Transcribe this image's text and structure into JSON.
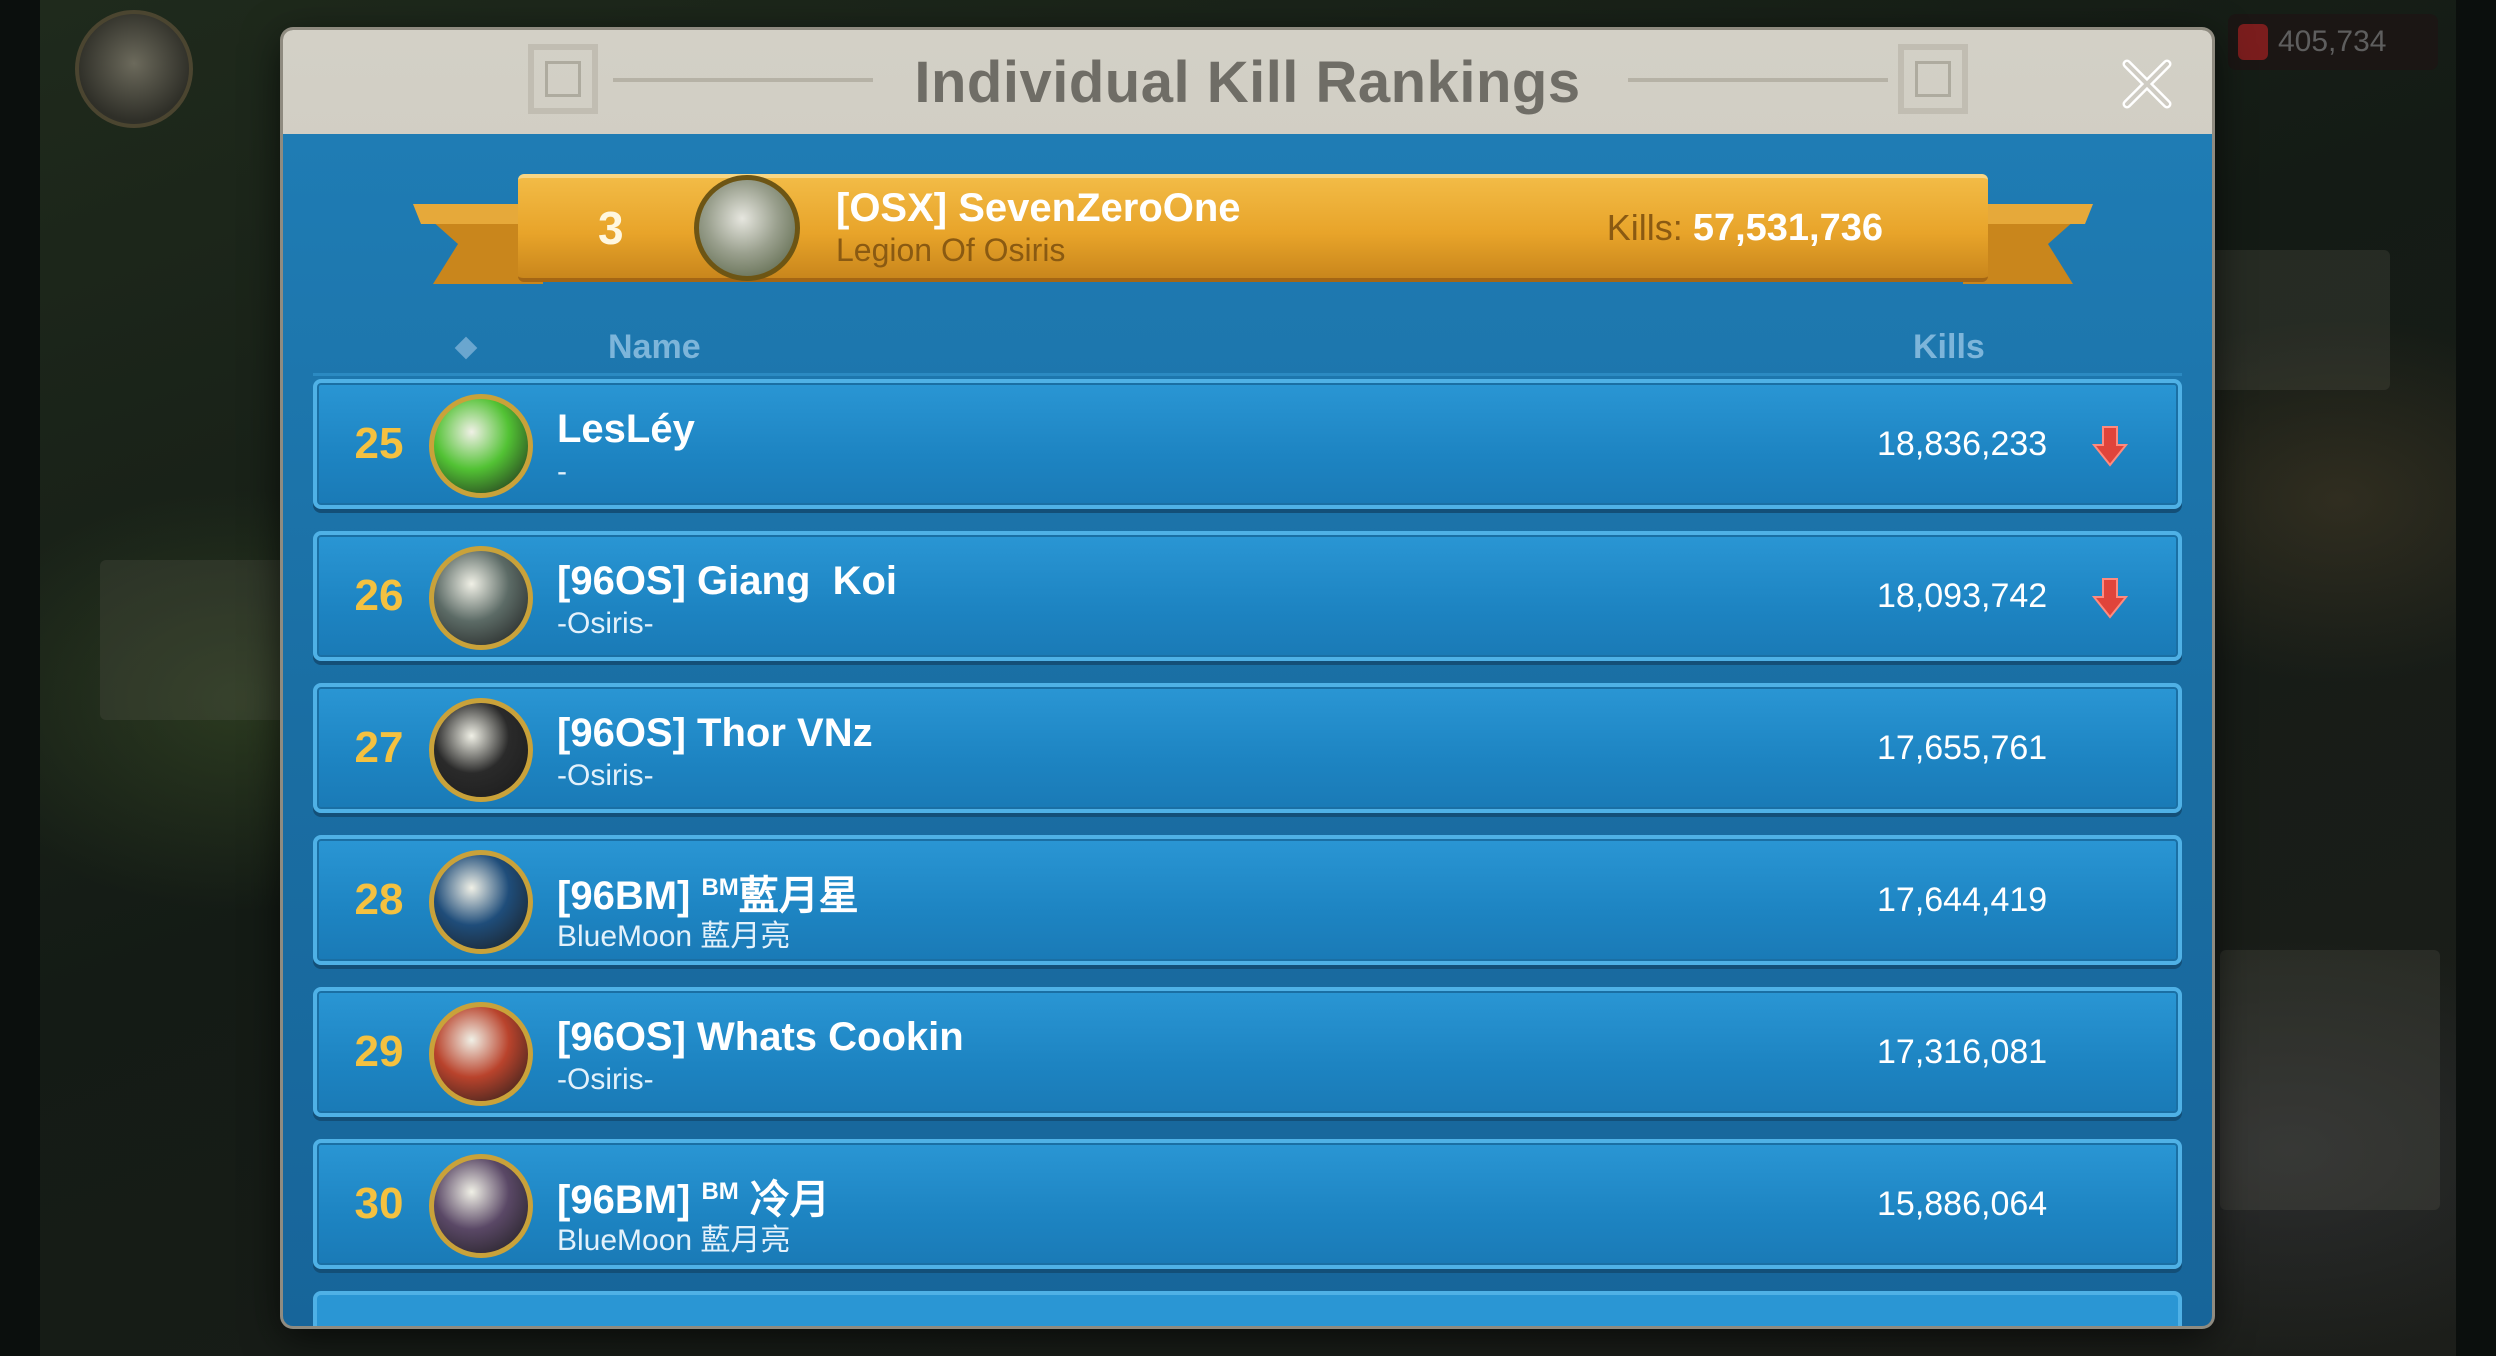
{
  "background": {
    "power_value": "405,734"
  },
  "modal": {
    "title": "Individual Kill Rankings"
  },
  "own_entry": {
    "rank": "3",
    "name": "[OSX] SevenZeroOne",
    "alliance": "Legion Of Osiris",
    "kills_label": "Kills:",
    "kills_value": "57,531,736"
  },
  "columns": {
    "name": "Name",
    "kills": "Kills"
  },
  "rows": [
    {
      "rank": "25",
      "tag": "",
      "sup": "",
      "name": "LesLéy",
      "alliance": "-",
      "kills": "18,836,233",
      "trend": "down",
      "avatar_color": "#52c234"
    },
    {
      "rank": "26",
      "tag": "[96OS] ",
      "sup": "",
      "name": "Giang  Koi",
      "alliance": "-Osiris-",
      "kills": "18,093,742",
      "trend": "down",
      "avatar_color": "#5c6b66"
    },
    {
      "rank": "27",
      "tag": "[96OS] ",
      "sup": "",
      "name": "Thor VNz",
      "alliance": "-Osiris-",
      "kills": "17,655,761",
      "trend": "",
      "avatar_color": "#2a2a2a"
    },
    {
      "rank": "28",
      "tag": "[96BM] ",
      "sup": "BM",
      "name": "藍月星",
      "alliance": "BlueMoon 藍月亮",
      "kills": "17,644,419",
      "trend": "",
      "avatar_color": "#1f4d7a"
    },
    {
      "rank": "29",
      "tag": "[96OS] ",
      "sup": "",
      "name": "Whats Cookin",
      "alliance": "-Osiris-",
      "kills": "17,316,081",
      "trend": "",
      "avatar_color": "#b9432c"
    },
    {
      "rank": "30",
      "tag": "[96BM] ",
      "sup": "BM",
      "name": " 冷月",
      "alliance": "BlueMoon 藍月亮",
      "kills": "15,886,064",
      "trend": "",
      "avatar_color": "#5a4866"
    }
  ],
  "colors": {
    "rank_gold": "#f4c140",
    "trend_down": "#e0443a",
    "panel_blue": "#1f7cb4",
    "ribbon_gold": "#e8a42a"
  },
  "icons": {
    "close": "close-icon",
    "trend_down": "arrow-down-icon",
    "sort": "diamond-icon"
  }
}
